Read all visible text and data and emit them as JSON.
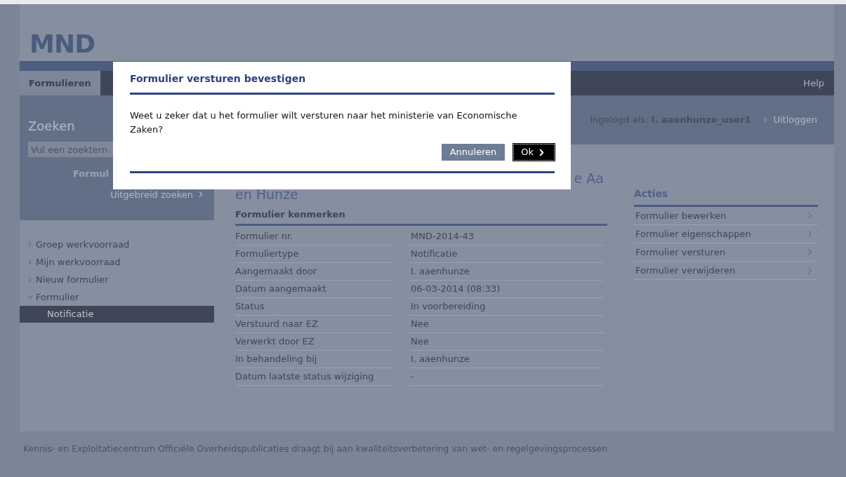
{
  "logo": "MND",
  "nav": {
    "tabs": [
      {
        "label": "Formulieren",
        "selected": true
      }
    ],
    "help": "Help"
  },
  "search": {
    "title": "Zoeken",
    "placeholder": "Vul een zoektern",
    "button": "Formul",
    "advanced": "Uitgebreid zoeken"
  },
  "user": {
    "label": "Ingelogd als:",
    "name": "I. aaenhunze_user1",
    "logout": "Uitloggen"
  },
  "sidebar": {
    "items": [
      {
        "label": "Groep werkvoorraad",
        "expanded": false,
        "selected": false
      },
      {
        "label": "Mijn werkvoorraad",
        "expanded": false,
        "selected": false
      },
      {
        "label": "Nieuw formulier",
        "expanded": false,
        "selected": false
      },
      {
        "label": "Formulier",
        "expanded": true,
        "selected": false,
        "children": [
          {
            "label": "Notificatie",
            "selected": true
          }
        ]
      }
    ]
  },
  "page_title": {
    "line_1": "e Aa",
    "line_2": "en Hunze"
  },
  "properties": {
    "title": "Formulier kenmerken",
    "rows": [
      {
        "label": "Formulier nr.",
        "value": "MND-2014-43"
      },
      {
        "label": "Formuliertype",
        "value": "Notificatie"
      },
      {
        "label": "Aangemaakt door",
        "value": "I. aaenhunze"
      },
      {
        "label": "Datum aangemaakt",
        "value": "06-03-2014 (08:33)"
      },
      {
        "label": "Status",
        "value": "In voorbereiding"
      },
      {
        "label": "Verstuurd naar EZ",
        "value": "Nee"
      },
      {
        "label": "Verwerkt door EZ",
        "value": "Nee"
      },
      {
        "label": "In behandeling bij",
        "value": "I. aaenhunze"
      },
      {
        "label": "Datum laatste status wijziging",
        "value": "-"
      }
    ]
  },
  "actions": {
    "title": "Acties",
    "items": [
      "Formulier bewerken",
      "Formulier eigenschappen",
      "Formulier versturen",
      "Formulier verwijderen"
    ]
  },
  "footer": "Kennis- en Exploitatiecentrum Officiële Overheidspublicaties draagt bij aan kwaliteitsverbetering van wet- en regelgevingsprocessen",
  "dialog": {
    "title": "Formulier versturen bevestigen",
    "message": "Weet u zeker dat u het formulier wilt versturen naar het ministerie van Economische Zaken?",
    "cancel": "Annuleren",
    "ok": "Ok"
  }
}
